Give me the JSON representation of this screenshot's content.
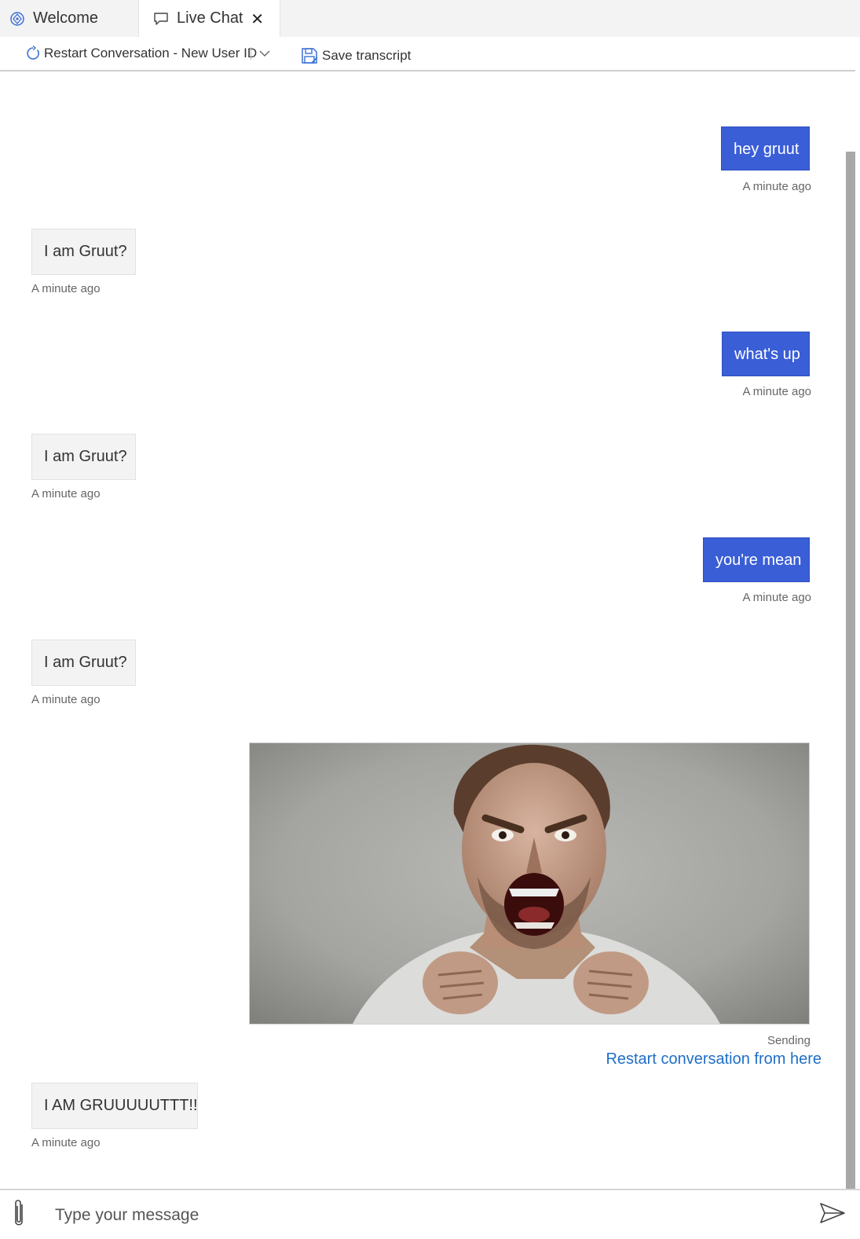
{
  "tabs": {
    "welcome": "Welcome",
    "live_chat": "Live Chat",
    "close_glyph": "✕"
  },
  "toolbar": {
    "restart": "Restart Conversation - New User ID",
    "save": "Save transcript"
  },
  "messages": [
    {
      "from": "user",
      "text": "hey gruut",
      "time": "A minute ago"
    },
    {
      "from": "bot",
      "text": "I am Gruut?",
      "time": "A minute ago"
    },
    {
      "from": "user",
      "text": "what's up",
      "time": "A minute ago"
    },
    {
      "from": "bot",
      "text": "I am Gruut?",
      "time": "A minute ago"
    },
    {
      "from": "user",
      "text": "you're mean",
      "time": "A minute ago"
    },
    {
      "from": "bot",
      "text": "I am Gruut?",
      "time": "A minute ago"
    },
    {
      "from": "user",
      "attachment": "image",
      "status": "Sending",
      "action": "Restart conversation from here"
    },
    {
      "from": "bot",
      "text": "I AM GRUUUUUTTT!!",
      "time": "A minute ago"
    }
  ],
  "input": {
    "placeholder": "Type your message",
    "value": ""
  },
  "colors": {
    "user_bubble": "#3a5ed6",
    "bot_bubble": "#f3f3f3",
    "link": "#1f6fc8",
    "tab_bar": "#f3f3f3"
  },
  "icons": {
    "welcome_tab": "bot-emulator-icon",
    "live_chat_tab": "chat-bubble-icon",
    "restart": "refresh-icon",
    "dropdown": "chevron-down-icon",
    "save": "save-icon",
    "attach": "paperclip-icon",
    "send": "send-icon"
  }
}
